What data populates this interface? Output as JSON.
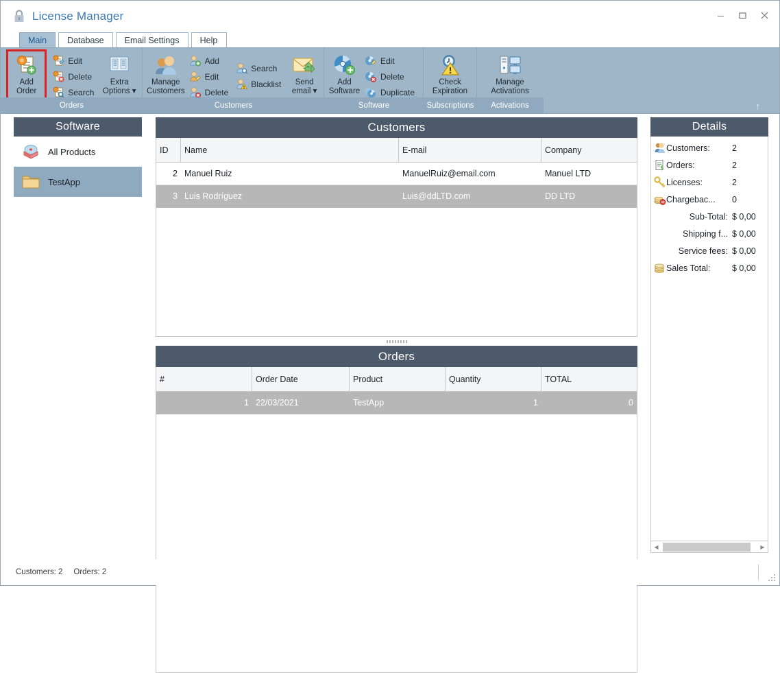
{
  "window": {
    "title": "License Manager",
    "icon": "lock-icon",
    "controls": {
      "minimize": "–",
      "maximize": "❐",
      "close": "✕"
    }
  },
  "tabs": [
    {
      "label": "Main",
      "active": true
    },
    {
      "label": "Database",
      "active": false
    },
    {
      "label": "Email Settings",
      "active": false
    },
    {
      "label": "Help",
      "active": false
    }
  ],
  "ribbon": {
    "expand_icon": "↑",
    "groups": [
      {
        "caption": "Orders",
        "big": [
          {
            "label_line1": "Add",
            "label_line2": "Order",
            "icon": "add-order-icon",
            "highlighted": true
          },
          {
            "label_line1": "Extra",
            "label_line2": "Options ▾",
            "icon": "extra-options-icon",
            "highlighted": false
          }
        ],
        "small": [
          {
            "label": "Edit",
            "icon": "edit-order-icon"
          },
          {
            "label": "Delete",
            "icon": "delete-order-icon"
          },
          {
            "label": "Search",
            "icon": "search-order-icon"
          }
        ]
      },
      {
        "caption": "Customers",
        "big": [
          {
            "label_line1": "Manage",
            "label_line2": "Customers",
            "icon": "manage-customers-icon",
            "highlighted": false
          },
          {
            "label_line1": "Send",
            "label_line2": "email ▾",
            "icon": "send-email-icon",
            "highlighted": false
          }
        ],
        "small_a": [
          {
            "label": "Add",
            "icon": "add-customer-icon"
          },
          {
            "label": "Edit",
            "icon": "edit-customer-icon"
          },
          {
            "label": "Delete",
            "icon": "delete-customer-icon"
          }
        ],
        "small_b": [
          {
            "label": "Search",
            "icon": "search-customer-icon"
          },
          {
            "label": "Blacklist",
            "icon": "blacklist-customer-icon"
          }
        ]
      },
      {
        "caption": "Software",
        "big": [
          {
            "label_line1": "Add",
            "label_line2": "Software",
            "icon": "add-software-icon",
            "highlighted": false
          }
        ],
        "small": [
          {
            "label": "Edit",
            "icon": "edit-software-icon"
          },
          {
            "label": "Delete",
            "icon": "delete-software-icon"
          },
          {
            "label": "Duplicate",
            "icon": "duplicate-software-icon"
          }
        ]
      },
      {
        "caption": "Subscriptions",
        "big": [
          {
            "label_line1": "Check",
            "label_line2": "Expiration",
            "icon": "check-expiration-icon",
            "highlighted": false
          }
        ],
        "small": []
      },
      {
        "caption": "Activations",
        "big": [
          {
            "label_line1": "Manage",
            "label_line2": "Activations",
            "icon": "manage-activations-icon",
            "highlighted": false
          }
        ],
        "small": []
      }
    ]
  },
  "software_panel": {
    "title": "Software",
    "items": [
      {
        "label": "All Products",
        "icon": "cd-box-icon",
        "selected": false
      },
      {
        "label": "TestApp",
        "icon": "folder-icon",
        "selected": true
      }
    ]
  },
  "customers_panel": {
    "title": "Customers",
    "columns": [
      "ID",
      "Name",
      "E-mail",
      "Company"
    ],
    "rows": [
      {
        "id": "2",
        "name": "Manuel Ruiz",
        "email": "ManuelRuiz@email.com",
        "company": "Manuel LTD",
        "selected": false
      },
      {
        "id": "3",
        "name": "Luis Rodríguez",
        "email": "Luis@ddLTD.com",
        "company": "DD LTD",
        "selected": true
      }
    ]
  },
  "orders_panel": {
    "title": "Orders",
    "columns": [
      "#",
      "Order Date",
      "Product",
      "Quantity",
      "TOTAL"
    ],
    "rows": [
      {
        "num": "1",
        "date": "22/03/2021",
        "product": "TestApp",
        "quantity": "1",
        "total": "0",
        "selected": true
      }
    ]
  },
  "details_panel": {
    "title": "Details",
    "rows": [
      {
        "label": "Customers:",
        "value": "2",
        "icon": "customers-icon",
        "align": "left"
      },
      {
        "label": "Orders:",
        "value": "2",
        "icon": "order-doc-icon",
        "align": "left"
      },
      {
        "label": "Licenses:",
        "value": "2",
        "icon": "key-icon",
        "align": "left"
      },
      {
        "label": "Chargebac...",
        "value": "0",
        "icon": "chargeback-icon",
        "align": "left"
      },
      {
        "label": "Sub-Total:",
        "value": "$ 0,00",
        "icon": "",
        "align": "right"
      },
      {
        "label": "Shipping f...",
        "value": "$ 0,00",
        "icon": "",
        "align": "right"
      },
      {
        "label": "Service fees:",
        "value": "$ 0,00",
        "icon": "",
        "align": "right"
      },
      {
        "label": "Sales Total:",
        "value": "$ 0,00",
        "icon": "coins-icon",
        "align": "left"
      }
    ]
  },
  "statusbar": {
    "customers": "Customers: 2",
    "orders": "Orders: 2"
  },
  "colors": {
    "ribbon_bg": "#9fb6c9",
    "group_strip": "#90a9bf",
    "panel_header": "#4c5a6b",
    "selection": "#b7b7b7",
    "sidebar_selection": "#8fa9bf",
    "title_text": "#3c78b4",
    "highlight_outline": "#e02020"
  }
}
